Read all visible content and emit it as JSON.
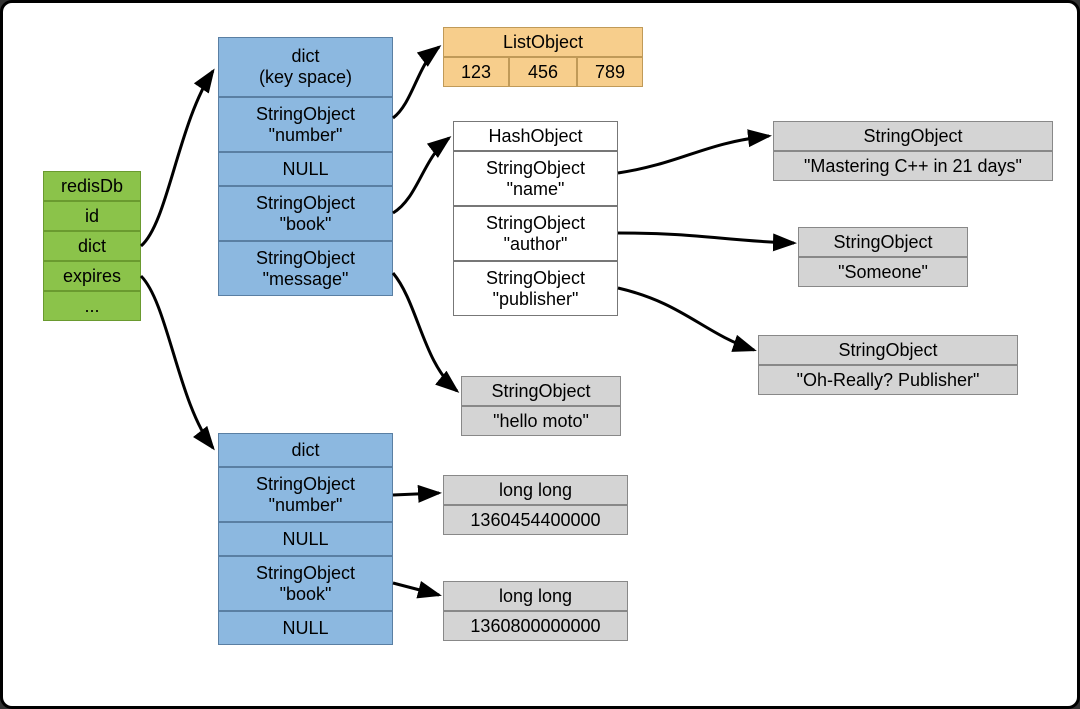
{
  "redisDb": {
    "header": "redisDb",
    "fields": [
      "id",
      "dict",
      "expires",
      "..."
    ]
  },
  "keySpaceDict": {
    "header_line1": "dict",
    "header_line2": "(key space)",
    "entries": [
      {
        "label_line1": "StringObject",
        "label_line2": "\"number\""
      },
      {
        "label_line1": "NULL",
        "label_line2": ""
      },
      {
        "label_line1": "StringObject",
        "label_line2": "\"book\""
      },
      {
        "label_line1": "StringObject",
        "label_line2": "\"message\""
      }
    ]
  },
  "listObject": {
    "header": "ListObject",
    "items": [
      "123",
      "456",
      "789"
    ]
  },
  "hashObject": {
    "header": "HashObject",
    "fields": [
      {
        "line1": "StringObject",
        "line2": "\"name\""
      },
      {
        "line1": "StringObject",
        "line2": "\"author\""
      },
      {
        "line1": "StringObject",
        "line2": "\"publisher\""
      }
    ]
  },
  "hashValues": {
    "name": {
      "header": "StringObject",
      "value": "\"Mastering C++ in 21 days\""
    },
    "author": {
      "header": "StringObject",
      "value": "\"Someone\""
    },
    "publisher": {
      "header": "StringObject",
      "value": "\"Oh-Really? Publisher\""
    }
  },
  "messageValue": {
    "header": "StringObject",
    "value": "\"hello moto\""
  },
  "expiresDict": {
    "header": "dict",
    "entries": [
      {
        "line1": "StringObject",
        "line2": "\"number\""
      },
      {
        "line1": "NULL",
        "line2": ""
      },
      {
        "line1": "StringObject",
        "line2": "\"book\""
      },
      {
        "line1": "NULL",
        "line2": ""
      }
    ]
  },
  "longLong1": {
    "header": "long long",
    "value": "1360454400000"
  },
  "longLong2": {
    "header": "long long",
    "value": "1360800000000"
  }
}
